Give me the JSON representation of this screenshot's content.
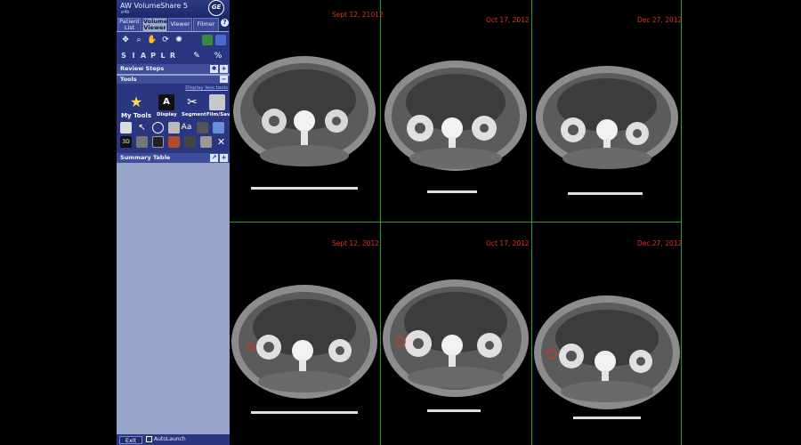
{
  "app": {
    "title": "AW VolumeShare 5",
    "subtitle": "e4b",
    "logo_text": "GE"
  },
  "tabs": [
    {
      "label_line1": "Patient",
      "label_line2": "List"
    },
    {
      "label_line1": "Volume",
      "label_line2": "Viewer"
    },
    {
      "label_line1": "Viewer",
      "label_line2": ""
    },
    {
      "label_line1": "Filmer",
      "label_line2": ""
    }
  ],
  "help_label": "?",
  "view_letters": [
    "S",
    "I",
    "A",
    "P",
    "L",
    "R"
  ],
  "sections": {
    "review_steps": "Review Steps",
    "tools": "Tools",
    "display_less": "Display less tools",
    "summary_table": "Summary Table"
  },
  "tools": {
    "my_tools": "My Tools",
    "display": "Display",
    "segment": "Segment",
    "film_save": "Film/Save"
  },
  "bottom": {
    "exit": "Exit",
    "autolaunch": "AutoLaunch"
  },
  "viewports": [
    {
      "date": "Sept 12, 21012"
    },
    {
      "date": "Oct 17, 2012"
    },
    {
      "date": "Dec 27, 2012"
    },
    {
      "date": "Sept 12, 2012"
    },
    {
      "date": "Oct 17, 2012"
    },
    {
      "date": "Dec 27, 2012"
    }
  ],
  "colors": {
    "grid": "#18a818",
    "date_text": "#e2311e",
    "panel": "#9eaacb",
    "titlebar": "#1d2a6a"
  }
}
